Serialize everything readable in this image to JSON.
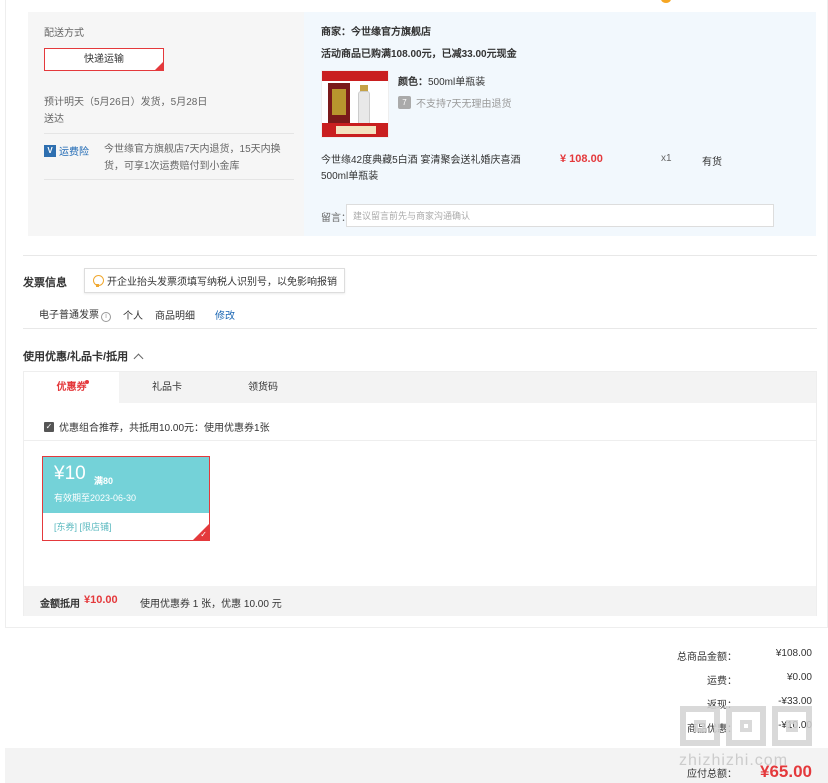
{
  "delivery": {
    "method_label": "配送方式",
    "method_option": "快递运输",
    "eta_line1": "预计明天（5月26日）发货，5月28日",
    "eta_line2": "送达",
    "insurance_badge": "运费险",
    "insurance_text": "今世缘官方旗舰店7天内退货，15天内换货，可享1次运费赔付到小金库"
  },
  "shop": {
    "merchant": "商家：今世缘官方旗舰店",
    "promo": "活动商品已购满108.00元，已减33.00元现金"
  },
  "product": {
    "color_label": "颜色：",
    "color_value": "500ml单瓶装",
    "return_policy": "不支持7天无理由退货",
    "name": "今世缘42度典藏5白酒 宴清聚会送礼婚庆喜酒500ml单瓶装",
    "price": "¥ 108.00",
    "qty": "x1",
    "stock": "有货"
  },
  "remark": {
    "label": "留言：",
    "placeholder": "建议留言前先与商家沟通确认"
  },
  "invoice": {
    "title": "发票信息",
    "tip": "开企业抬头发票须填写纳税人识别号，以免影响报销",
    "type": "电子普通发票",
    "type_info": "i",
    "holder": "个人",
    "content": "商品明细",
    "edit": "修改"
  },
  "coupons": {
    "title": "使用优惠/礼品卡/抵用",
    "tabs": [
      "优惠券",
      "礼品卡",
      "领货码"
    ],
    "recommend": "优惠组合推荐，共抵用10.00元：使用优惠券1张",
    "coupon": {
      "amount": "¥10",
      "condition": "满80",
      "expiry": "有效期至2023-06-30",
      "tags": "[东券] [限店铺]"
    },
    "footer_label": "金额抵用",
    "footer_value": "¥10.00",
    "footer_desc": "使用优惠券 1 张，优惠 10.00 元"
  },
  "summary": {
    "rows": [
      {
        "k": "总商品金额：",
        "v": "¥108.00"
      },
      {
        "k": "运费：",
        "v": "¥0.00"
      },
      {
        "k": "返现：",
        "v": "-¥33.00"
      },
      {
        "k": "商品优惠：",
        "v": "-¥10.00"
      }
    ],
    "payable_label": "应付总额：",
    "payable_value": "¥65.00"
  },
  "watermark": "zhizhizhi.com",
  "colors": {
    "accent": "#e4393c",
    "coupon": "#74d2d8",
    "link": "#1a66b3"
  }
}
